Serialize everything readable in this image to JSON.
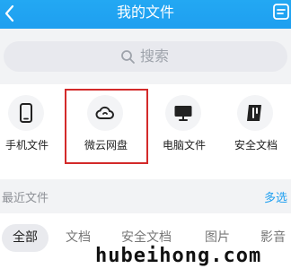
{
  "header": {
    "title": "我的文件",
    "back_icon": "chevron-left-icon",
    "sort_icon": "sort-icon"
  },
  "search": {
    "placeholder": "搜索"
  },
  "quick_access": [
    {
      "label": "手机文件",
      "icon": "phone-icon"
    },
    {
      "label": "微云网盘",
      "icon": "cloud-icon"
    },
    {
      "label": "电脑文件",
      "icon": "monitor-icon"
    },
    {
      "label": "安全文档",
      "icon": "secure-doc-icon"
    }
  ],
  "recent": {
    "title": "最近文件",
    "action": "多选"
  },
  "filters": [
    {
      "label": "全部",
      "selected": true
    },
    {
      "label": "文档",
      "selected": false
    },
    {
      "label": "安全文档",
      "selected": false
    },
    {
      "label": "图片",
      "selected": false
    },
    {
      "label": "影音",
      "selected": false
    }
  ],
  "watermark": "hubeihong.com",
  "colors": {
    "header_bg": "#1e9ff0",
    "accent": "#1e9ff0",
    "highlight_border": "#d32a2a"
  }
}
